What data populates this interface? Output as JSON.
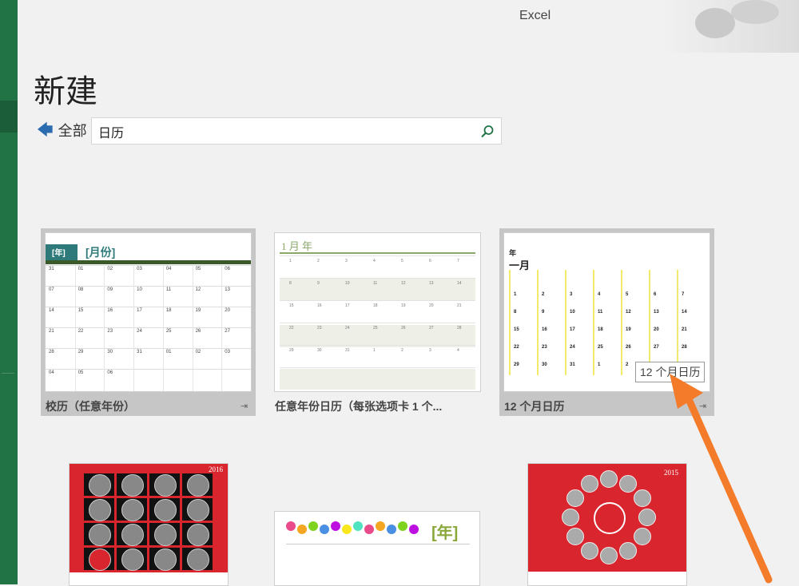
{
  "app": {
    "title": "Excel"
  },
  "page": {
    "title": "新建"
  },
  "nav": {
    "back_label": "全部"
  },
  "search": {
    "value": "日历",
    "placeholder": ""
  },
  "templates": [
    {
      "label": "校历（任意年份）",
      "thumb_header": "[年]",
      "thumb_title": "[月份]"
    },
    {
      "label": "任意年份日历（每张选项卡 1 个...",
      "thumb_title": "1 月 年"
    },
    {
      "label": "12 个月日历",
      "thumb_title": "一月",
      "thumb_year": "年",
      "tooltip": "12 个月日历"
    }
  ],
  "bottom_row": [
    {
      "year": "2016"
    },
    {
      "thumb_title": "[年]"
    },
    {
      "year": "2015"
    }
  ],
  "school_calendar": {
    "rows": [
      [
        "31",
        "01",
        "02",
        "03",
        "04",
        "05",
        "06"
      ],
      [
        "07",
        "08",
        "09",
        "10",
        "11",
        "12",
        "13"
      ],
      [
        "14",
        "15",
        "16",
        "17",
        "18",
        "19",
        "20"
      ],
      [
        "21",
        "22",
        "23",
        "24",
        "25",
        "26",
        "27"
      ],
      [
        "28",
        "29",
        "30",
        "31",
        "01",
        "02",
        "03"
      ],
      [
        "04",
        "05",
        "06",
        "",
        "",
        "",
        ""
      ]
    ]
  },
  "twelve_month": {
    "days": [
      [
        "1",
        "2",
        "3",
        "4",
        "5",
        "6",
        "7"
      ],
      [
        "8",
        "9",
        "10",
        "11",
        "12",
        "13",
        "14"
      ],
      [
        "15",
        "16",
        "17",
        "18",
        "19",
        "20",
        "21"
      ],
      [
        "22",
        "23",
        "24",
        "25",
        "26",
        "27",
        "28"
      ],
      [
        "29",
        "30",
        "31",
        "1",
        "2",
        "3",
        "4"
      ]
    ]
  },
  "colors": {
    "excel_green": "#217346",
    "arrow": "#f47b2a",
    "accent_teal": "#2e7a7a"
  }
}
